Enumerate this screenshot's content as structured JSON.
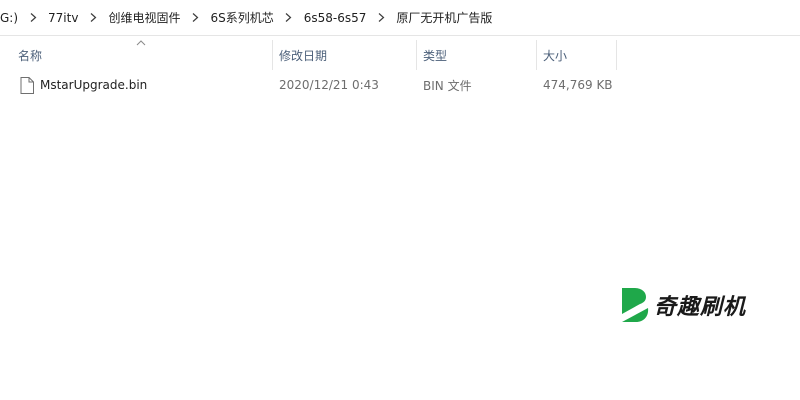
{
  "breadcrumb": {
    "items": [
      {
        "label": "G:)"
      },
      {
        "label": "77itv"
      },
      {
        "label": "创维电视固件"
      },
      {
        "label": "6S系列机芯"
      },
      {
        "label": "6s58-6s57"
      },
      {
        "label": "原厂无开机广告版"
      }
    ]
  },
  "columns": {
    "name": "名称",
    "date": "修改日期",
    "type": "类型",
    "size": "大小"
  },
  "files": [
    {
      "name": "MstarUpgrade.bin",
      "date": "2020/12/21 0:43",
      "type": "BIN 文件",
      "size": "474,769 KB",
      "icon": "file-icon"
    }
  ],
  "watermark": {
    "text": "奇趣刷机",
    "color": "#1fa84a"
  }
}
